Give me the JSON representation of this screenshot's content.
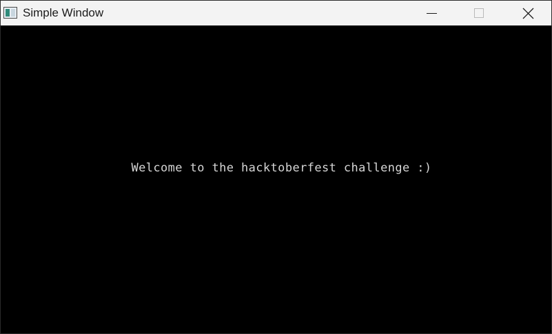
{
  "window": {
    "title": "Simple Window",
    "icon": "app-window-icon"
  },
  "titlebar_controls": {
    "minimize_icon": "minimize-icon",
    "maximize_icon": "maximize-icon",
    "close_icon": "close-icon"
  },
  "content": {
    "message": "Welcome to the hacktoberfest challenge :)",
    "background_color": "#000000",
    "text_color": "#d6d6d6"
  }
}
